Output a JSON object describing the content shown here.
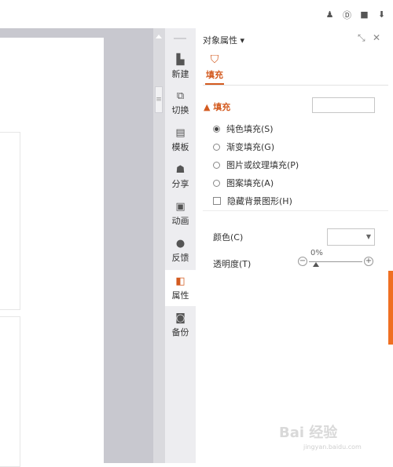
{
  "toolbar": {
    "icons": [
      "person-icon",
      "info-d-icon",
      "save-icon",
      "export-icon"
    ]
  },
  "side_tools": [
    {
      "label": "新建",
      "icon": "new-doc-icon"
    },
    {
      "label": "切换",
      "icon": "switch-icon"
    },
    {
      "label": "模板",
      "icon": "template-icon"
    },
    {
      "label": "分享",
      "icon": "share-icon"
    },
    {
      "label": "动画",
      "icon": "animation-icon"
    },
    {
      "label": "反馈",
      "icon": "feedback-icon"
    },
    {
      "label": "属性",
      "icon": "properties-icon",
      "active": true
    },
    {
      "label": "备份",
      "icon": "backup-icon"
    }
  ],
  "panel": {
    "title": "对象属性 ▾",
    "active_tab": "填充",
    "fill_section": "▲ 填充",
    "fill_options": [
      {
        "label": "纯色填充(S)",
        "selected": true
      },
      {
        "label": "渐变填充(G)",
        "selected": false
      },
      {
        "label": "图片或纹理填充(P)",
        "selected": false
      },
      {
        "label": "图案填充(A)",
        "selected": false
      }
    ],
    "hide_bg": {
      "label": "隐藏背景图形(H)",
      "checked": false
    },
    "color_label": "颜色(C)",
    "transparency_label": "透明度(T)",
    "transparency_value": "0%"
  },
  "watermark": {
    "brand": "Bai 经验",
    "url": "jingyan.baidu.com"
  },
  "colors": {
    "accent": "#d35a1f",
    "canvas": "#c8c8cf",
    "tool_bg": "#ededf0",
    "edge_tab": "#f06f22"
  }
}
